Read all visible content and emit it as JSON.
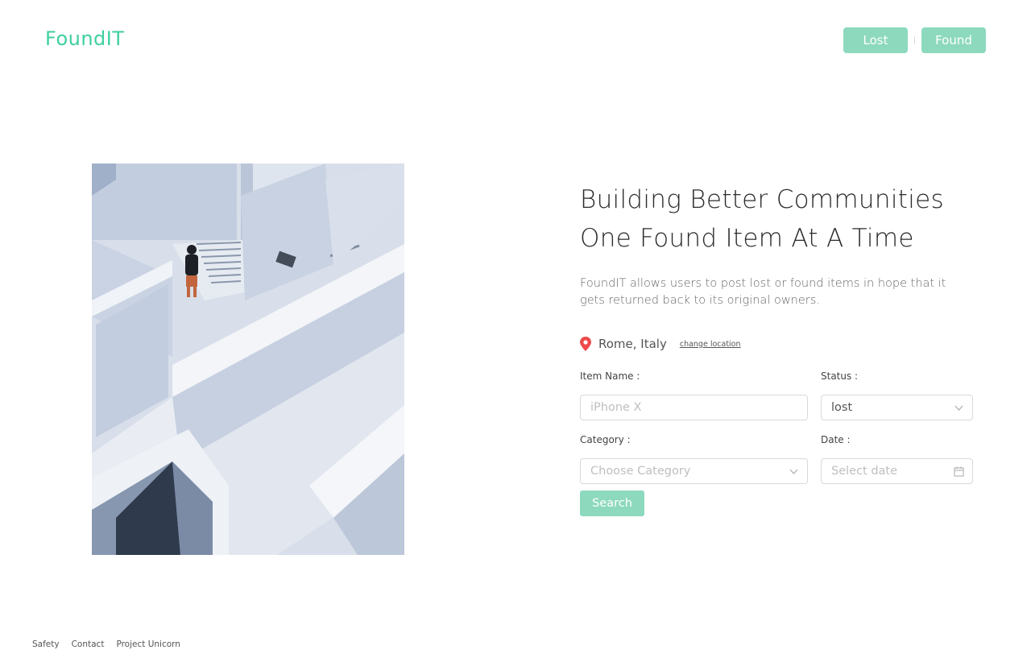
{
  "brand": {
    "name": "FoundIT",
    "color": "#3fcf9e",
    "accent": "#8dd9bd"
  },
  "nav": {
    "lost_label": "Lost",
    "found_label": "Found"
  },
  "hero": {
    "headline_line1": "Building Better Communities",
    "headline_line2": "One Found Item At A Time",
    "description": "FoundIT allows users to post lost or found items in hope that it gets returned back to its original owners."
  },
  "location": {
    "icon": "map-pin-icon",
    "text": "Rome, Italy",
    "change_label": "change location"
  },
  "form": {
    "item_name_label": "Item Name :",
    "item_name_placeholder": "iPhone X",
    "status_label": "Status :",
    "status_value": "lost",
    "category_label": "Category :",
    "category_placeholder": "Choose Category",
    "date_label": "Date :",
    "date_placeholder": "Select date",
    "search_label": "Search"
  },
  "footer": {
    "links": [
      "Safety",
      "Contact",
      "Project Unicorn"
    ]
  }
}
